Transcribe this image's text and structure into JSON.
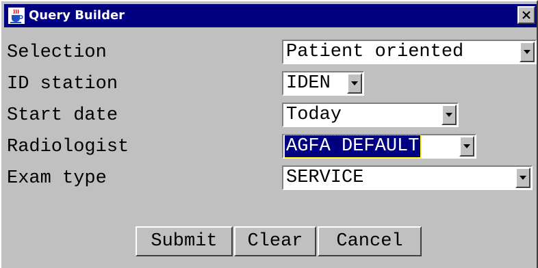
{
  "window": {
    "title": "Query Builder",
    "app_icon": "java-cup-icon",
    "close_icon": "close-icon"
  },
  "fields": [
    {
      "label": "Selection",
      "value": "Patient oriented",
      "highlighted": false
    },
    {
      "label": "ID station",
      "value": "IDEN",
      "highlighted": false
    },
    {
      "label": "Start date",
      "value": "Today",
      "highlighted": false
    },
    {
      "label": "Radiologist",
      "value": "AGFA DEFAULT",
      "highlighted": true
    },
    {
      "label": "Exam type",
      "value": "SERVICE",
      "highlighted": false
    }
  ],
  "buttons": {
    "submit": "Submit",
    "clear": "Clear",
    "cancel": "Cancel"
  },
  "colors": {
    "titlebar": "#000080",
    "face": "#c0c0c0",
    "selection": "#000080"
  }
}
